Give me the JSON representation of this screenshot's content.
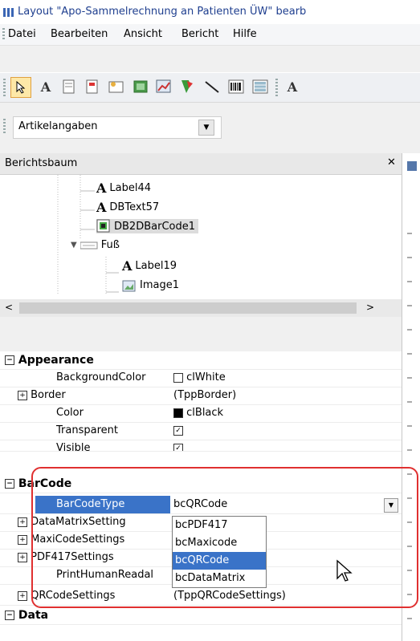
{
  "window": {
    "title": "Layout \"Apo-Sammelrechnung an Patienten ÜW\" bearb"
  },
  "menu": {
    "items": [
      "Datei",
      "Bearbeiten",
      "Ansicht",
      "Bericht",
      "Hilfe"
    ]
  },
  "toolbar": {
    "buttons": [
      "select-arrow-icon",
      "label-tool-icon",
      "memo-tool-icon",
      "richtext-tool-icon",
      "calc-tool-icon",
      "image-tool-icon",
      "chart-tool-icon",
      "shape-tool-icon",
      "line-tool-icon",
      "barcode-tool-icon",
      "table-tool-icon",
      "db-label-tool-icon"
    ]
  },
  "combo": {
    "value": "Artikelangaben"
  },
  "tree": {
    "title": "Berichtsbaum",
    "items": [
      {
        "label": "Label44",
        "icon": "label-icon"
      },
      {
        "label": "DBText57",
        "icon": "dbtext-icon"
      },
      {
        "label": "DB2DBarCode1",
        "icon": "barcode-icon"
      },
      {
        "label": "Fuß",
        "icon": "band-icon"
      },
      {
        "label": "Label19",
        "icon": "label-icon"
      },
      {
        "label": "Image1",
        "icon": "image-icon"
      }
    ]
  },
  "props": {
    "appearance": "Appearance",
    "background_color_name": "BackgroundColor",
    "background_color_val": "clWhite",
    "border_name": "Border",
    "border_val": "(TppBorder)",
    "color_name": "Color",
    "color_val": "clBlack",
    "transparent_name": "Transparent",
    "visible_name": "Visible",
    "barcode": "BarCode",
    "barcodetype_name": "BarCodeType",
    "barcodetype_val": "bcQRCode",
    "datamatrix_name": "DataMatrixSetting",
    "maxicode_name": "MaxiCodeSettings",
    "pdf417_name": "PDF417Settings",
    "printhuman_name": "PrintHumanReadal",
    "qrcode_name": "QRCodeSettings",
    "qrcode_val": "(TppQRCodeSettings)",
    "data": "Data"
  },
  "dropdown": {
    "options": [
      "bcPDF417",
      "bcMaxicode",
      "bcQRCode",
      "bcDataMatrix"
    ],
    "selected": "bcQRCode"
  },
  "colors": {
    "selection": "#3a73c8",
    "highlight": "#e03030",
    "title_text": "#1f3f8f"
  }
}
